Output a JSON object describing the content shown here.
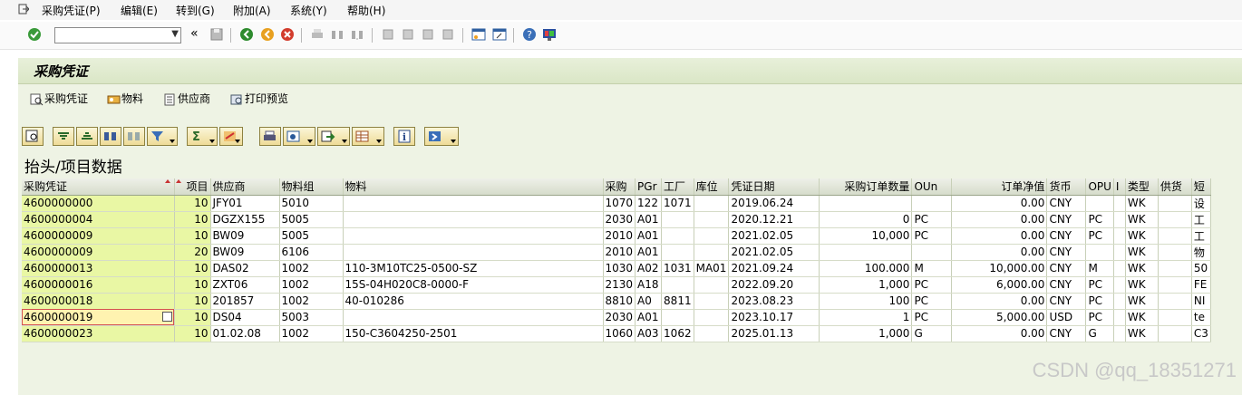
{
  "menu": [
    "采购凭证(P)",
    "编辑(E)",
    "转到(G)",
    "附加(A)",
    "系统(Y)",
    "帮助(H)"
  ],
  "window_title": "采购凭证",
  "app_toolbar": [
    "采购凭证",
    "物料",
    "供应商",
    "打印预览"
  ],
  "grid_title": "抬头/项目数据",
  "columns": [
    "采购凭证",
    "项目",
    "供应商",
    "物料组",
    "物料",
    "采购",
    "PGr",
    "工厂",
    "库位",
    "凭证日期",
    "采购订单数量",
    "OUn",
    "订单净值",
    "货币",
    "OPU",
    "I",
    "类型",
    "供货",
    "短"
  ],
  "rows": [
    [
      "4600000000",
      "10",
      "JFY01",
      "5010",
      "",
      "1070",
      "122",
      "1071",
      "",
      "2019.06.24",
      "",
      "",
      "0.00",
      "CNY",
      "",
      "",
      "WK",
      "",
      "设"
    ],
    [
      "4600000004",
      "10",
      "DGZX155",
      "5005",
      "",
      "2030",
      "A01",
      "",
      "",
      "2020.12.21",
      "0",
      "PC",
      "0.00",
      "CNY",
      "PC",
      "",
      "WK",
      "",
      "工"
    ],
    [
      "4600000009",
      "10",
      "BW09",
      "5005",
      "",
      "2010",
      "A01",
      "",
      "",
      "2021.02.05",
      "10,000",
      "PC",
      "0.00",
      "CNY",
      "PC",
      "",
      "WK",
      "",
      "工"
    ],
    [
      "4600000009",
      "20",
      "BW09",
      "6106",
      "",
      "2010",
      "A01",
      "",
      "",
      "2021.02.05",
      "",
      "",
      "0.00",
      "CNY",
      "",
      "",
      "WK",
      "",
      "物"
    ],
    [
      "4600000013",
      "10",
      "DAS02",
      "1002",
      "110-3M10TC25-0500-SZ",
      "1030",
      "A02",
      "1031",
      "MA01",
      "2021.09.24",
      "100.000",
      "M",
      "10,000.00",
      "CNY",
      "M",
      "",
      "WK",
      "",
      "50"
    ],
    [
      "4600000016",
      "10",
      "ZXT06",
      "1002",
      "15S-04H020C8-0000-F",
      "2130",
      "A18",
      "",
      "",
      "2022.09.20",
      "1,000",
      "PC",
      "6,000.00",
      "CNY",
      "PC",
      "",
      "WK",
      "",
      "FE"
    ],
    [
      "4600000018",
      "10",
      "201857",
      "1002",
      "40-010286",
      "8810",
      "A0",
      "8811",
      "",
      "2023.08.23",
      "100",
      "PC",
      "0.00",
      "CNY",
      "PC",
      "",
      "WK",
      "",
      "NI"
    ],
    [
      "4600000019",
      "10",
      "DS04",
      "5003",
      "",
      "2030",
      "A01",
      "",
      "",
      "2023.10.17",
      "1",
      "PC",
      "5,000.00",
      "USD",
      "PC",
      "",
      "WK",
      "",
      "te"
    ],
    [
      "4600000023",
      "10",
      "01.02.08",
      "1002",
      "150-C3604250-2501",
      "1060",
      "A03",
      "1062",
      "",
      "2025.01.13",
      "1,000",
      "G",
      "0.00",
      "CNY",
      "G",
      "",
      "WK",
      "",
      "C3"
    ]
  ],
  "watermark": "CSDN @qq_18351271"
}
